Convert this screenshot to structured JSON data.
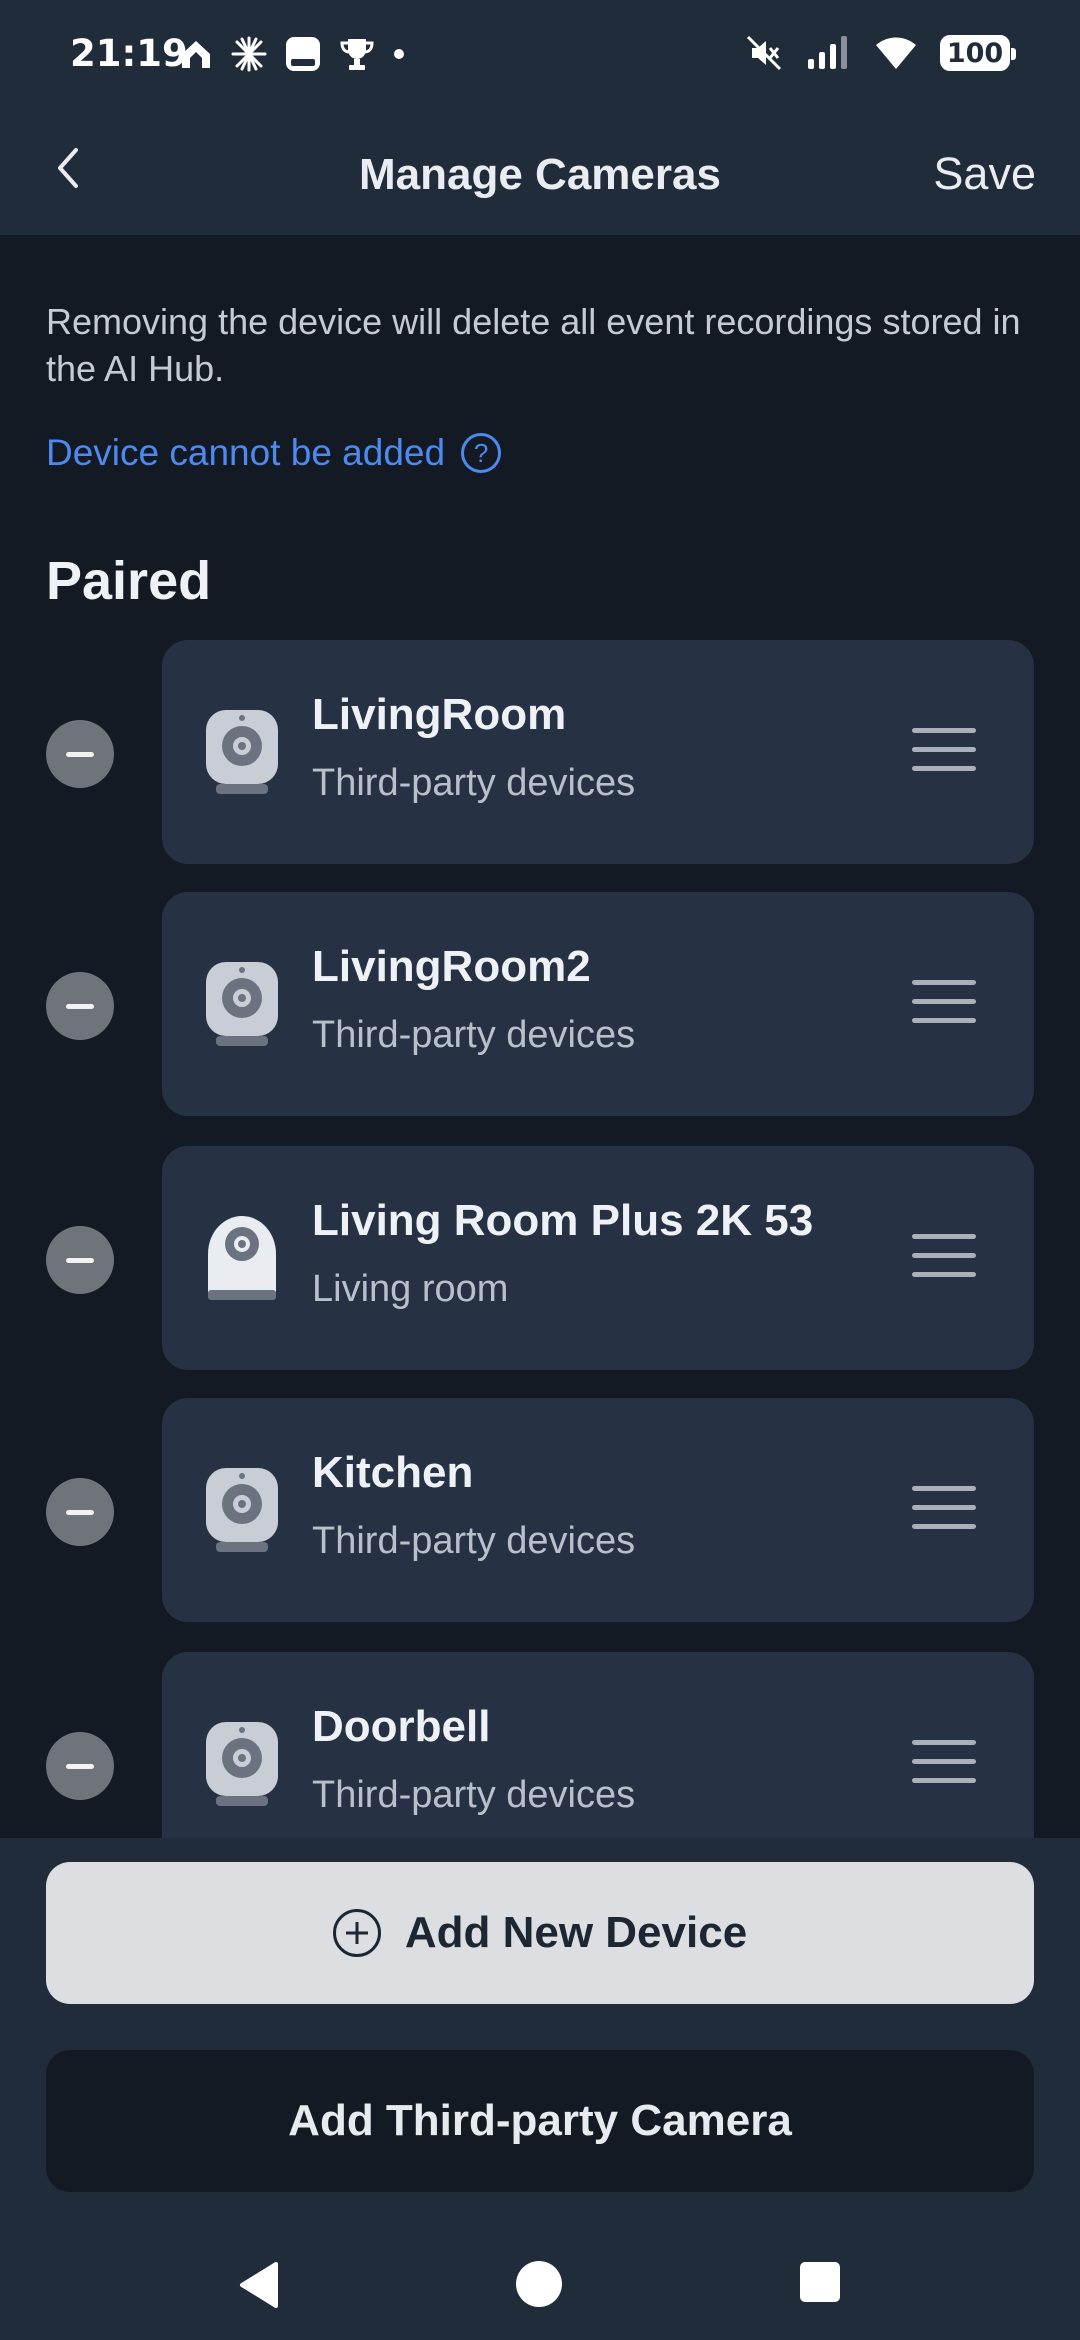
{
  "status_bar": {
    "time": "21:19",
    "battery": "100"
  },
  "header": {
    "title": "Manage Cameras",
    "save_label": "Save"
  },
  "notice": "Removing the device will delete all event recordings stored in the AI Hub.",
  "help_link": "Device cannot be added",
  "help_icon": "?",
  "section_title": "Paired",
  "devices": [
    {
      "name": "LivingRoom",
      "subtitle": "Third-party devices",
      "icon": "camera-icon"
    },
    {
      "name": "LivingRoom2",
      "subtitle": "Third-party devices",
      "icon": "camera-icon"
    },
    {
      "name": "Living Room Plus 2K 53",
      "subtitle": "Living room",
      "icon": "camera-plus-icon"
    },
    {
      "name": "Kitchen",
      "subtitle": "Third-party devices",
      "icon": "camera-icon"
    },
    {
      "name": "Doorbell",
      "subtitle": "Third-party devices",
      "icon": "camera-icon"
    }
  ],
  "buttons": {
    "add_new_device": "Add New Device",
    "add_third_party": "Add Third-party Camera"
  },
  "colors": {
    "background": "#131a24",
    "header": "#212c3b",
    "card": "#263244",
    "link": "#4d8af0"
  }
}
